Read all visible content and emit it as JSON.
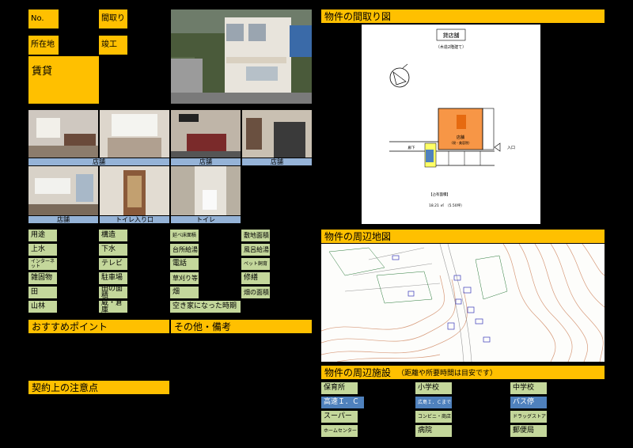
{
  "header": {
    "no_label": "No.",
    "madori_label": "間取り",
    "location_label": "所在地",
    "completion_label": "竣工",
    "rent_label": "賃貸"
  },
  "photo_captions": [
    "店舗",
    "店舗",
    "店舗",
    "店舗",
    "トイレ入り口",
    "トイレ"
  ],
  "props": {
    "col1": [
      "用途",
      "上水",
      "インターネット",
      "雑固物",
      "田",
      "山林"
    ],
    "col2": [
      "構造",
      "下水",
      "テレビ",
      "駐車場",
      "田の面積",
      "蔵・倉庫"
    ],
    "col3": [
      "延べ床面積",
      "台所給湯",
      "電話",
      "草刈り等",
      "畑",
      "空き家になった時期"
    ],
    "col4": [
      "敷地面積",
      "風呂給湯",
      "ペット飼育",
      "修繕",
      "畑の面積"
    ]
  },
  "sections": {
    "recommend": "おすすめポイント",
    "other": "その他・備考",
    "contract": "契約上の注意点"
  },
  "right": {
    "floorplan_title": "物件の間取り図",
    "map_title": "物件の周辺地図",
    "facility_title": "物件の周辺施設",
    "facility_note": "（距離や所要時間は目安です）"
  },
  "floorplan": {
    "title": "貸店舗",
    "subtitle": "（木造2階建て）",
    "room_label": "店舗",
    "room_sub": "（現・美容院）",
    "corridor": "廊下",
    "entrance": "入口",
    "area_label": "【占有面積】",
    "area_value": "18.21 ㎡　（5.50坪）"
  },
  "facilities": {
    "col1": [
      "保育所",
      "高速Ｉ．Ｃ",
      "スーパー",
      "ホームセンター"
    ],
    "col2": [
      "小学校",
      "広島Ｉ．Ｃまで",
      "コンビニ・商店",
      "病院"
    ],
    "col3": [
      "中学校",
      "バス停",
      "ドラッグストア",
      "郵便局"
    ]
  },
  "colors": {
    "accent": "#ffc000",
    "green": "#c4d79b",
    "blue": "#4f81bd",
    "caption_blue": "#95b3d7"
  }
}
